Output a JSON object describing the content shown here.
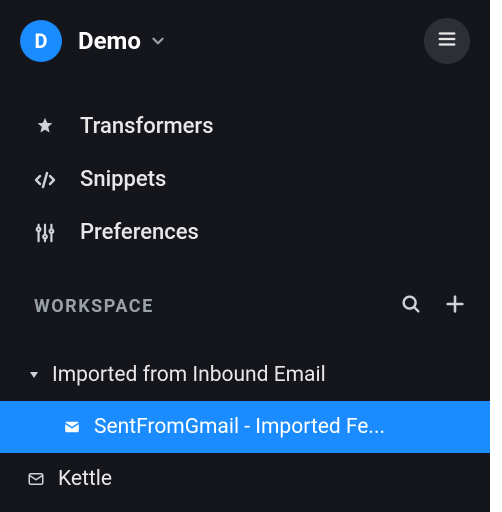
{
  "header": {
    "avatar_letter": "D",
    "workspace_name": "Demo"
  },
  "nav": {
    "items": [
      {
        "id": "transformers",
        "label": "Transformers",
        "icon": "star"
      },
      {
        "id": "snippets",
        "label": "Snippets",
        "icon": "code"
      },
      {
        "id": "preferences",
        "label": "Preferences",
        "icon": "sliders"
      }
    ]
  },
  "section": {
    "title": "WORKSPACE"
  },
  "tree": {
    "items": [
      {
        "id": "imported",
        "depth": 0,
        "expanded": true,
        "selected": false,
        "icon": "caret",
        "label": "Imported from Inbound Email"
      },
      {
        "id": "sentfromgmail",
        "depth": 1,
        "expanded": false,
        "selected": true,
        "icon": "mail",
        "label": "SentFromGmail - Imported Fe..."
      },
      {
        "id": "kettle",
        "depth": 0,
        "expanded": false,
        "selected": false,
        "icon": "mail",
        "label": "Kettle"
      }
    ]
  },
  "colors": {
    "accent": "#1b8cff",
    "bg": "#14161c"
  }
}
